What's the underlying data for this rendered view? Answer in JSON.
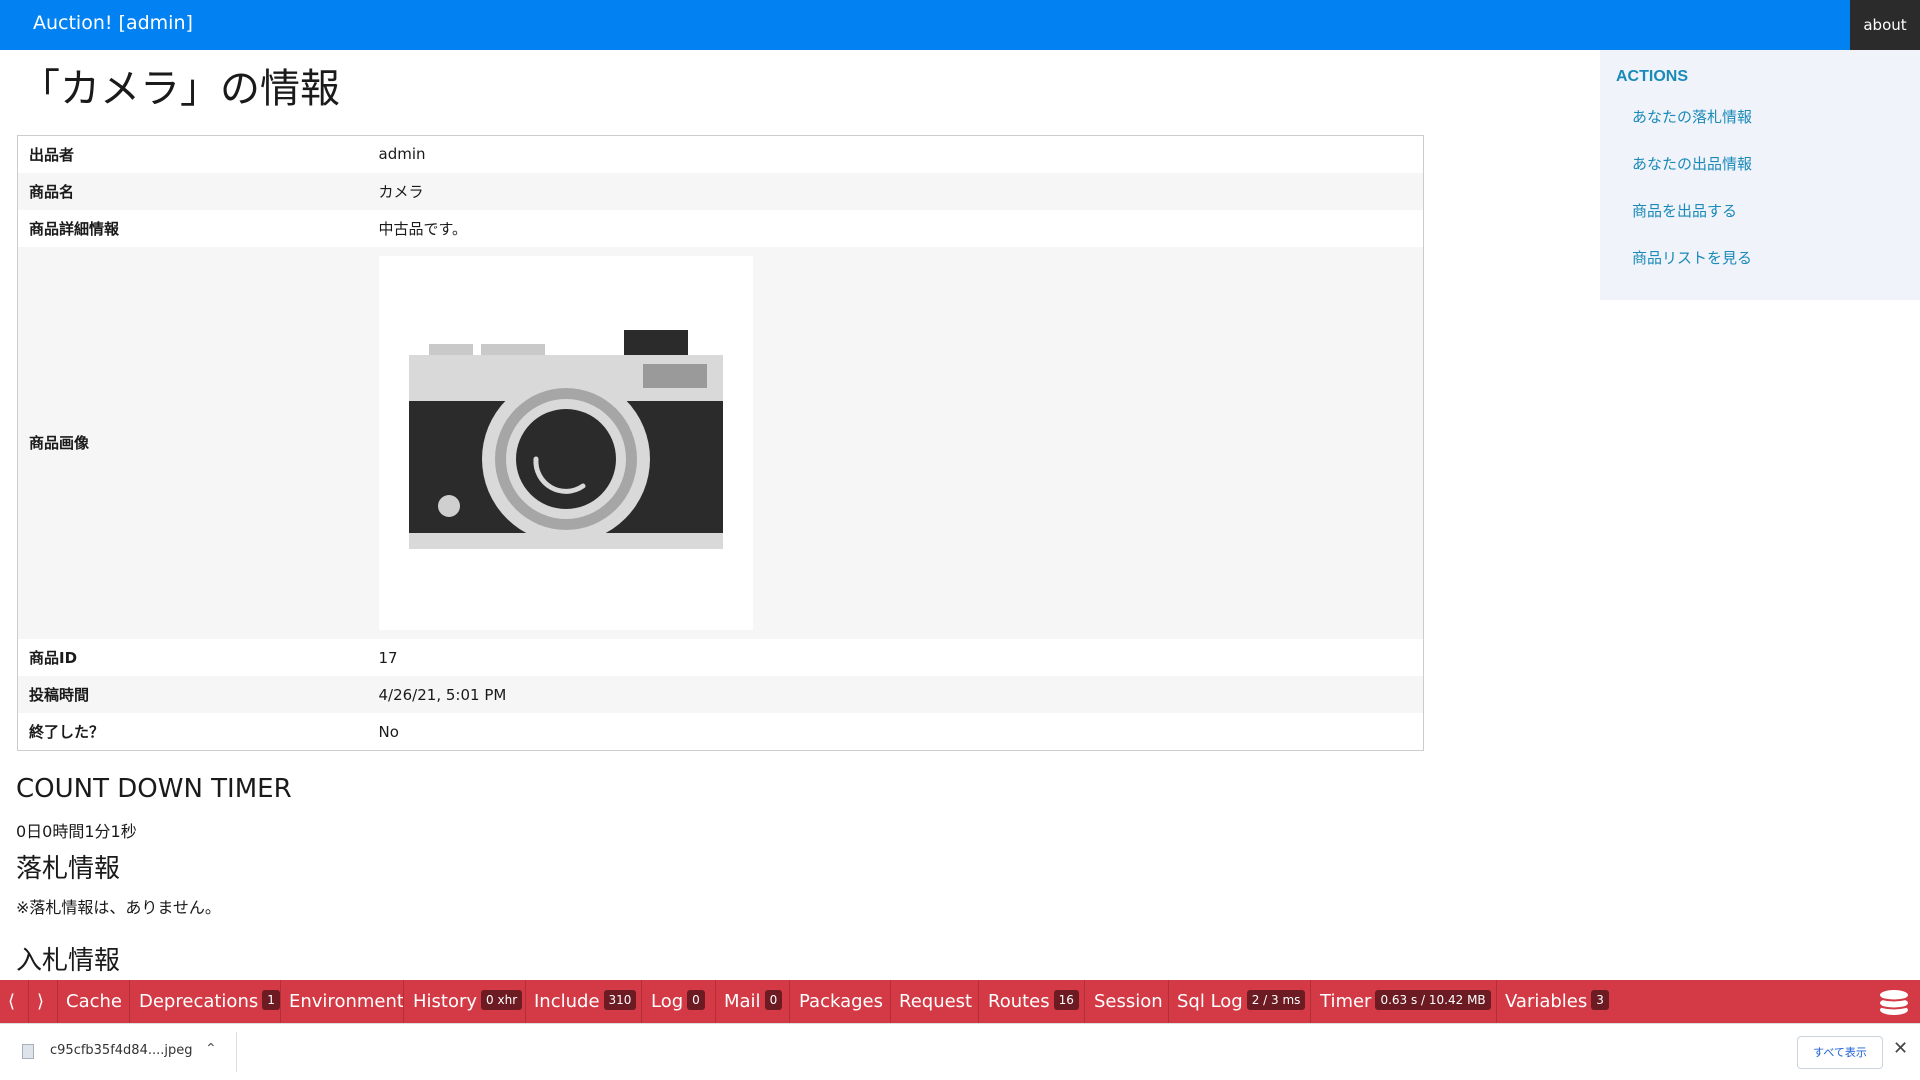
{
  "navbar": {
    "brand": "Auction! [admin]",
    "about": "about"
  },
  "sidebar": {
    "heading": "ACTIONS",
    "items": [
      "あなたの落札情報",
      "あなたの出品情報",
      "商品を出品する",
      "商品リストを見る"
    ]
  },
  "page": {
    "title": "「カメラ」の情報"
  },
  "details": {
    "rows": [
      {
        "label": "出品者",
        "value": "admin"
      },
      {
        "label": "商品名",
        "value": "カメラ"
      },
      {
        "label": "商品詳細情報",
        "value": "中古品です。"
      },
      {
        "label": "商品画像",
        "value": ""
      },
      {
        "label": "商品ID",
        "value": "17"
      },
      {
        "label": "投稿時間",
        "value": "4/26/21, 5:01 PM"
      },
      {
        "label": "終了した？",
        "value": "No"
      }
    ]
  },
  "countdown": {
    "heading": "COUNT DOWN TIMER",
    "value": "0日0時間1分1秒"
  },
  "winning": {
    "heading": "落札情報",
    "message": "※落札情報は、ありません。"
  },
  "bidding": {
    "heading": "入札情報"
  },
  "debugkit": {
    "items": [
      {
        "label": "Cache",
        "badge": ""
      },
      {
        "label": "Deprecations",
        "badge": "1"
      },
      {
        "label": "Environment",
        "badge": ""
      },
      {
        "label": "History",
        "badge": "0 xhr"
      },
      {
        "label": "Include",
        "badge": "310"
      },
      {
        "label": "Log",
        "badge": "0"
      },
      {
        "label": "Mail",
        "badge": "0"
      },
      {
        "label": "Packages",
        "badge": ""
      },
      {
        "label": "Request",
        "badge": ""
      },
      {
        "label": "Routes",
        "badge": "16"
      },
      {
        "label": "Session",
        "badge": ""
      },
      {
        "label": "Sql Log",
        "badge": "2 / 3 ms"
      },
      {
        "label": "Timer",
        "badge": "0.63 s / 10.42 MB"
      },
      {
        "label": "Variables",
        "badge": "3"
      }
    ]
  },
  "downloads": {
    "file": "c95cfb35f4d84....jpeg",
    "show_all": "すべて表示"
  },
  "colors": {
    "navbar": "#0282f2",
    "debugbar": "#d33a45",
    "link": "#1a8ab8"
  },
  "icons": [
    "chevron-left-icon",
    "chevron-right-icon",
    "debugkit-logo-icon",
    "file-icon",
    "chevron-up-icon",
    "close-icon"
  ]
}
